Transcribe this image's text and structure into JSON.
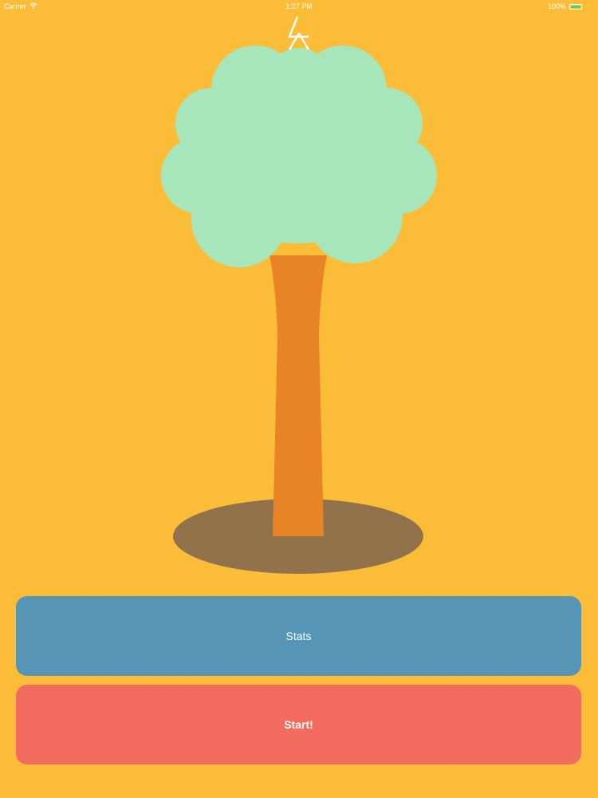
{
  "status_bar": {
    "carrier": "Carrier",
    "time": "1:27 PM",
    "battery_percent": "100%"
  },
  "colors": {
    "background": "#FBBD37",
    "canopy": "#A6E6BA",
    "trunk": "#E88426",
    "ground_shadow": "#91724A",
    "stats_button": "#5695B5",
    "start_button": "#F16B5E",
    "battery_fill": "#4cd964"
  },
  "icons": {
    "logo": "triangle-logo-icon",
    "wifi": "wifi-icon",
    "battery": "battery-icon",
    "charging": "charging-bolt-icon"
  },
  "buttons": {
    "stats_label": "Stats",
    "start_label": "Start!"
  }
}
